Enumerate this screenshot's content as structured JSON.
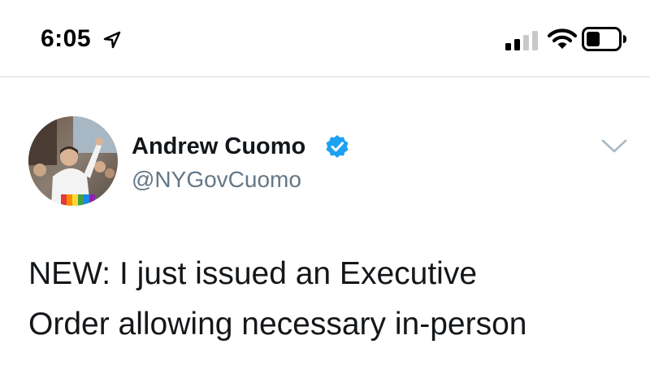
{
  "status_bar": {
    "time": "6:05",
    "icons": [
      "location-arrow-icon",
      "cellular-signal-icon",
      "wifi-icon",
      "battery-icon"
    ]
  },
  "tweet": {
    "author": {
      "name": "Andrew Cuomo",
      "handle": "@NYGovCuomo",
      "verified": true
    },
    "text_lines": [
      "NEW: I just issued an Executive",
      "Order allowing necessary in-person"
    ]
  },
  "colors": {
    "verified_blue": "#1da1f2",
    "handle_gray": "#657786",
    "chevron_gray": "#aab8c2",
    "divider": "#d8d8d8"
  }
}
